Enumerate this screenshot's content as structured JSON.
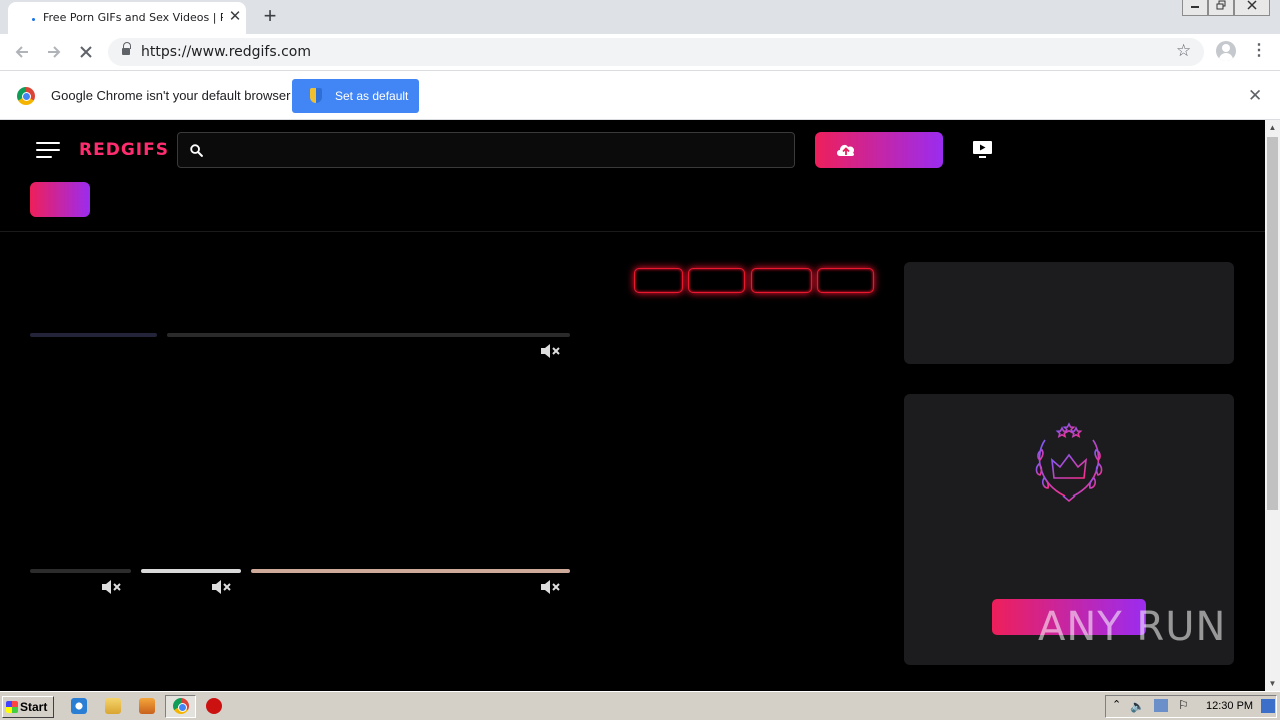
{
  "browser": {
    "tab_title": "Free Porn GIFs and Sex Videos | Red",
    "tab_close": "✕",
    "new_tab": "+",
    "url": "https://www.redgifs.com",
    "window_controls": [
      "minimize",
      "restore",
      "close"
    ]
  },
  "infobar": {
    "message": "Google Chrome isn't your default browser",
    "button": "Set as default",
    "close": "✕"
  },
  "site": {
    "logo": "REDGIFS",
    "search_placeholder": "",
    "accent_pink": "#ee1f5a",
    "accent_purple": "#9b2cf0",
    "chip_border": "#e8182f"
  },
  "watermark": "ANY RUN",
  "taskbar": {
    "start": "Start",
    "clock": "12:30 PM",
    "pinned": [
      "internet-explorer-icon",
      "file-explorer-icon",
      "media-player-icon",
      "chrome-icon",
      "antivirus-icon"
    ]
  }
}
